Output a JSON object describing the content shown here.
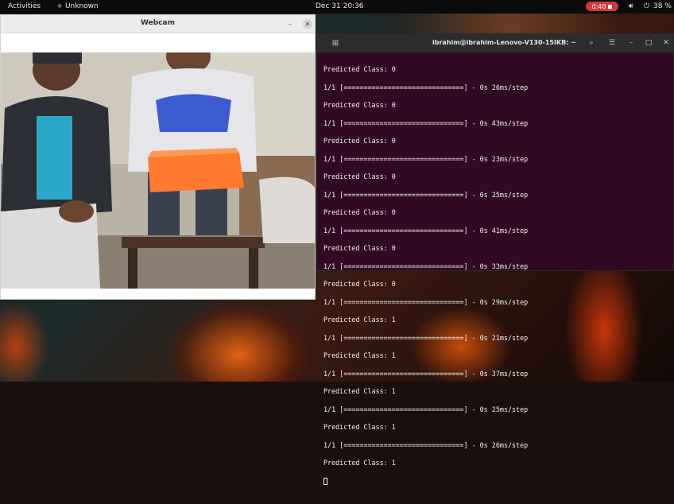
{
  "topbar": {
    "activities": "Activities",
    "app_name": "Unknown",
    "clock": "Dec 31  20:36",
    "recording_time": "0:40",
    "battery": "38 %"
  },
  "webcam_window": {
    "title": "Webcam"
  },
  "terminal": {
    "title": "ibrahim@ibrahim-Lenovo-V130-15IKB: ~",
    "lines": [
      "Predicted Class: 0",
      "1/1 [==============================] - 0s 26ms/step",
      "Predicted Class: 0",
      "1/1 [==============================] - 0s 43ms/step",
      "Predicted Class: 0",
      "1/1 [==============================] - 0s 23ms/step",
      "Predicted Class: 0",
      "1/1 [==============================] - 0s 25ms/step",
      "Predicted Class: 0",
      "1/1 [==============================] - 0s 41ms/step",
      "Predicted Class: 0",
      "1/1 [==============================] - 0s 33ms/step",
      "Predicted Class: 0",
      "1/1 [==============================] - 0s 29ms/step",
      "Predicted Class: 1",
      "1/1 [==============================] - 0s 21ms/step",
      "Predicted Class: 1",
      "1/1 [==============================] - 0s 37ms/step",
      "Predicted Class: 1",
      "1/1 [==============================] - 0s 25ms/step",
      "Predicted Class: 1",
      "1/1 [==============================] - 0s 26ms/step",
      "Predicted Class: 1"
    ]
  },
  "icons": {
    "app": "ubuntu-app-icon",
    "record": "record-stop-icon",
    "volume": "volume-icon",
    "power": "power-icon",
    "new_tab": "new-tab-icon",
    "search": "search-icon",
    "menu": "hamburger-menu-icon",
    "minimize": "minimize-icon",
    "maximize": "maximize-icon",
    "close": "close-icon"
  },
  "colors": {
    "terminal_bg": "#300a24",
    "record_badge": "#d43a3a",
    "box_orange": "#ff7a2e"
  }
}
